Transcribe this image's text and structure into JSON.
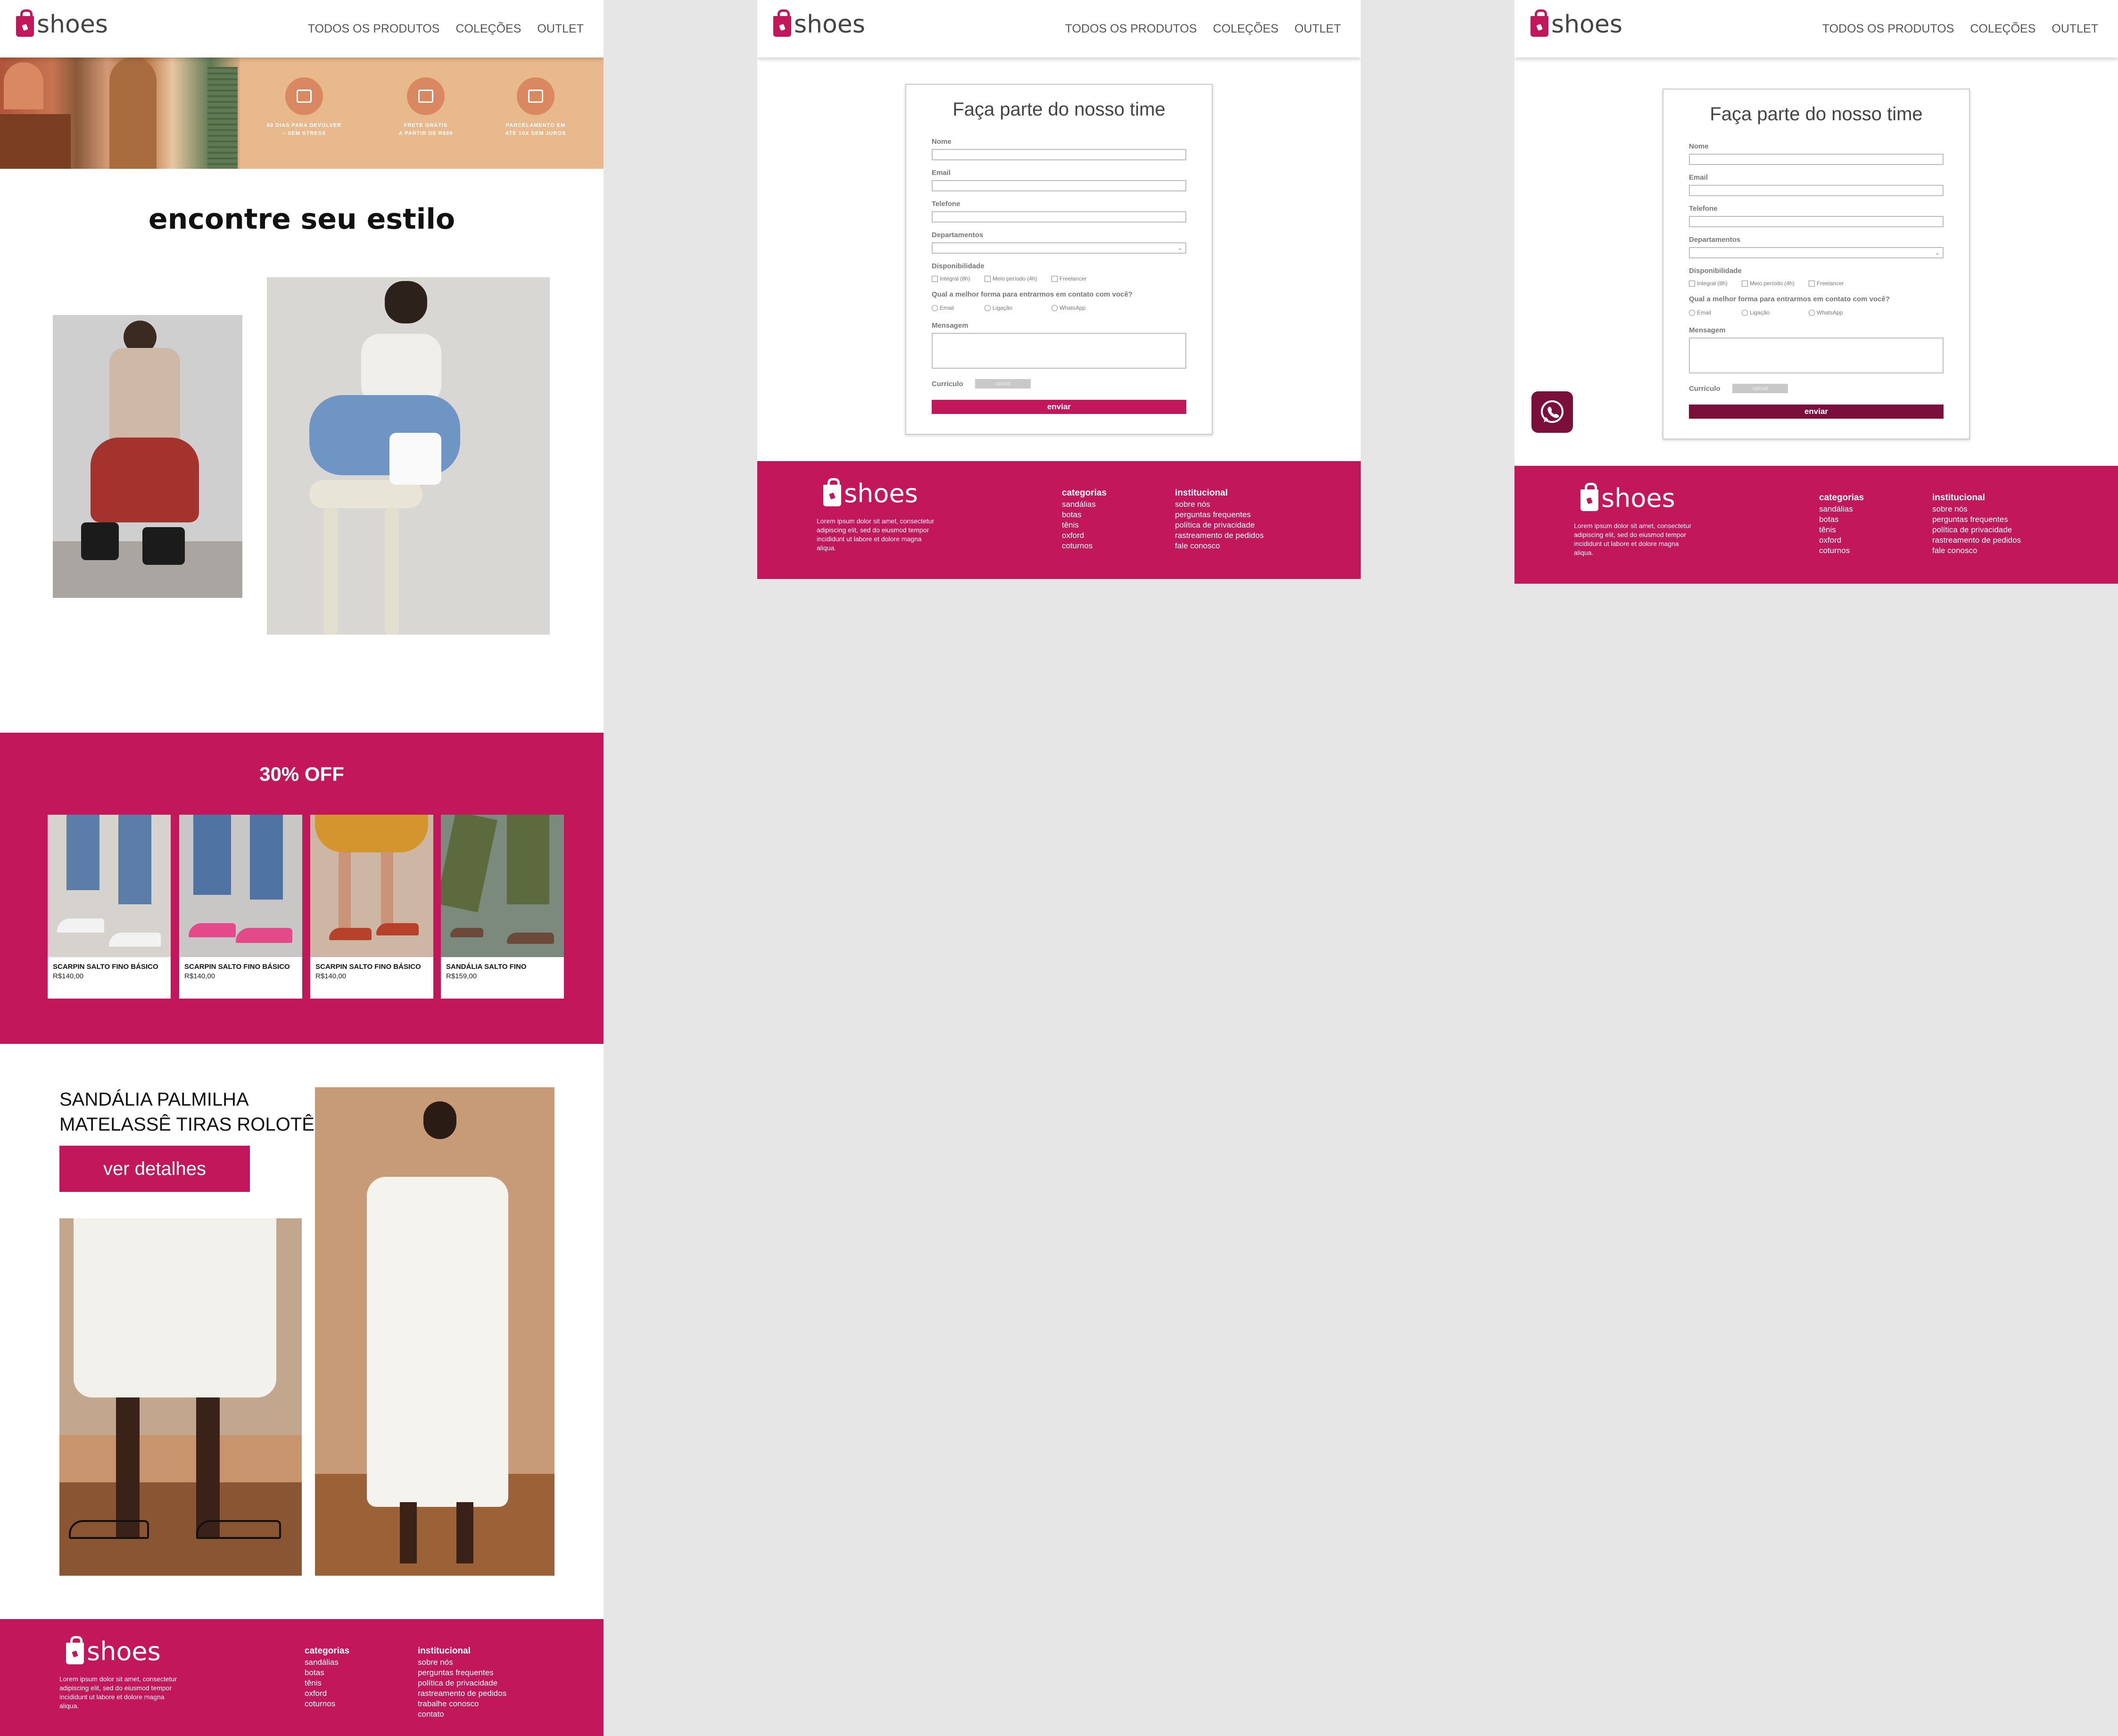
{
  "brand": {
    "name": "shoes",
    "color": "#c2185b",
    "dark_color": "#7b0f3b"
  },
  "nav": {
    "all_products": "TODOS OS PRODUTOS",
    "collections": "COLEÇÕES",
    "outlet": "OUTLET"
  },
  "hero": {
    "perks": [
      {
        "icon": "return-box-icon",
        "line1": "60 DIAS PARA DEVOLVER",
        "line2": "– SEM STRESS"
      },
      {
        "icon": "truck-icon",
        "line1": "FRETE GRÁTIS",
        "line2": "A PARTIR DE R$99"
      },
      {
        "icon": "wallet-icon",
        "line1": "PARCELAMENTO EM",
        "line2": "ATÉ 10X SEM JUROS"
      }
    ]
  },
  "style_section": {
    "title": "encontre seu estilo"
  },
  "sale": {
    "title": "30% OFF",
    "products": [
      {
        "name": "SCARPIN SALTO FINO BÁSICO",
        "price": "R$140,00",
        "shoe_color": "#f2f2f2"
      },
      {
        "name": "SCARPIN SALTO FINO BÁSICO",
        "price": "R$140,00",
        "shoe_color": "#e44a8a"
      },
      {
        "name": "SCARPIN SALTO FINO BÁSICO",
        "price": "R$140,00",
        "shoe_color": "#b8412c"
      },
      {
        "name": "SANDÁLIA SALTO FINO",
        "price": "R$159,00",
        "shoe_color": "#6b4a3a"
      }
    ]
  },
  "feature": {
    "title_line1": "SANDÁLIA PALMILHA",
    "title_line2": "MATELASSÊ TIRAS ROLOTÊ",
    "button": "ver detalhes"
  },
  "form": {
    "title": "Faça parte do nosso time",
    "name_label": "Nome",
    "email_label": "Email",
    "phone_label": "Telefone",
    "departments_label": "Departamentos",
    "availability_label": "Disponibilidade",
    "availability_options": [
      "Integral (8h)",
      "Meio período (4h)",
      "Freelancer"
    ],
    "contact_question": "Qual a melhor forma para entrarmos em contato com você?",
    "contact_options": [
      "Email",
      "Ligação",
      "WhatsApp"
    ],
    "message_label": "Mensagem",
    "resume_label": "Currículo",
    "upload_label": "upload",
    "submit": "enviar"
  },
  "footer": {
    "lorem": "Lorem ipsum dolor sit amet, consectetur adipiscing elit, sed do eiusmod tempor incididunt ut labore et dolore magna aliqua.",
    "categories_title": "categorias",
    "categories": [
      "sandálias",
      "botas",
      "tênis",
      "oxford",
      "coturnos"
    ],
    "institutional_title": "institucional",
    "institutional": [
      "sobre nós",
      "perguntas frequentes",
      "política de privacidade",
      "rastreamento de pedidos",
      "fale conosco"
    ],
    "institutional_extended": [
      "sobre nós",
      "perguntas frequentes",
      "política de privacidade",
      "rastreamento de pedidos",
      "trabalhe conosco",
      "contato"
    ]
  }
}
